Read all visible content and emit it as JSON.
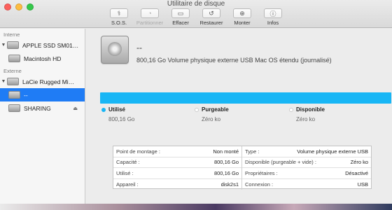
{
  "window": {
    "title": "Utilitaire de disque"
  },
  "toolbar": {
    "buttons": [
      {
        "label": "S.O.S.",
        "icon": "stethoscope-icon",
        "enabled": true
      },
      {
        "label": "Partitionner",
        "icon": "pie-chart-icon",
        "enabled": false
      },
      {
        "label": "Effacer",
        "icon": "erase-icon",
        "enabled": true
      },
      {
        "label": "Restaurer",
        "icon": "restore-icon",
        "enabled": true
      },
      {
        "label": "Monter",
        "icon": "mount-icon",
        "enabled": true
      },
      {
        "label": "Infos",
        "icon": "info-icon",
        "enabled": true
      }
    ]
  },
  "sidebar": {
    "internal_label": "Interne",
    "external_label": "Externe",
    "items": [
      {
        "label": "APPLE SSD SM01…"
      },
      {
        "label": "Macintosh HD"
      },
      {
        "label": "LaCie Rugged Mi…"
      },
      {
        "label": "--"
      },
      {
        "label": "SHARING"
      }
    ]
  },
  "volume": {
    "name": "--",
    "description": "800,16 Go Volume physique externe USB Mac OS étendu (journalisé)"
  },
  "usage": {
    "used_fraction": 1.0,
    "bar_color": "#18b6f5",
    "legend": [
      {
        "label": "Utilisé",
        "value": "800,16 Go",
        "color": "#18b6f5"
      },
      {
        "label": "Purgeable",
        "value": "Zéro ko",
        "color": "#ffffff"
      },
      {
        "label": "Disponible",
        "value": "Zéro ko",
        "color": "#ffffff"
      }
    ]
  },
  "info": {
    "left": [
      {
        "key": "Point de montage :",
        "value": "Non monté"
      },
      {
        "key": "Capacité :",
        "value": "800,16 Go"
      },
      {
        "key": "Utilisé :",
        "value": "800,16 Go"
      },
      {
        "key": "Appareil :",
        "value": "disk2s1"
      }
    ],
    "right": [
      {
        "key": "Type :",
        "value": "Volume physique externe USB"
      },
      {
        "key": "Disponible (purgeable + vide) :",
        "value": "Zéro ko"
      },
      {
        "key": "Propriétaires :",
        "value": "Désactivé"
      },
      {
        "key": "Connexion :",
        "value": "USB"
      }
    ]
  }
}
